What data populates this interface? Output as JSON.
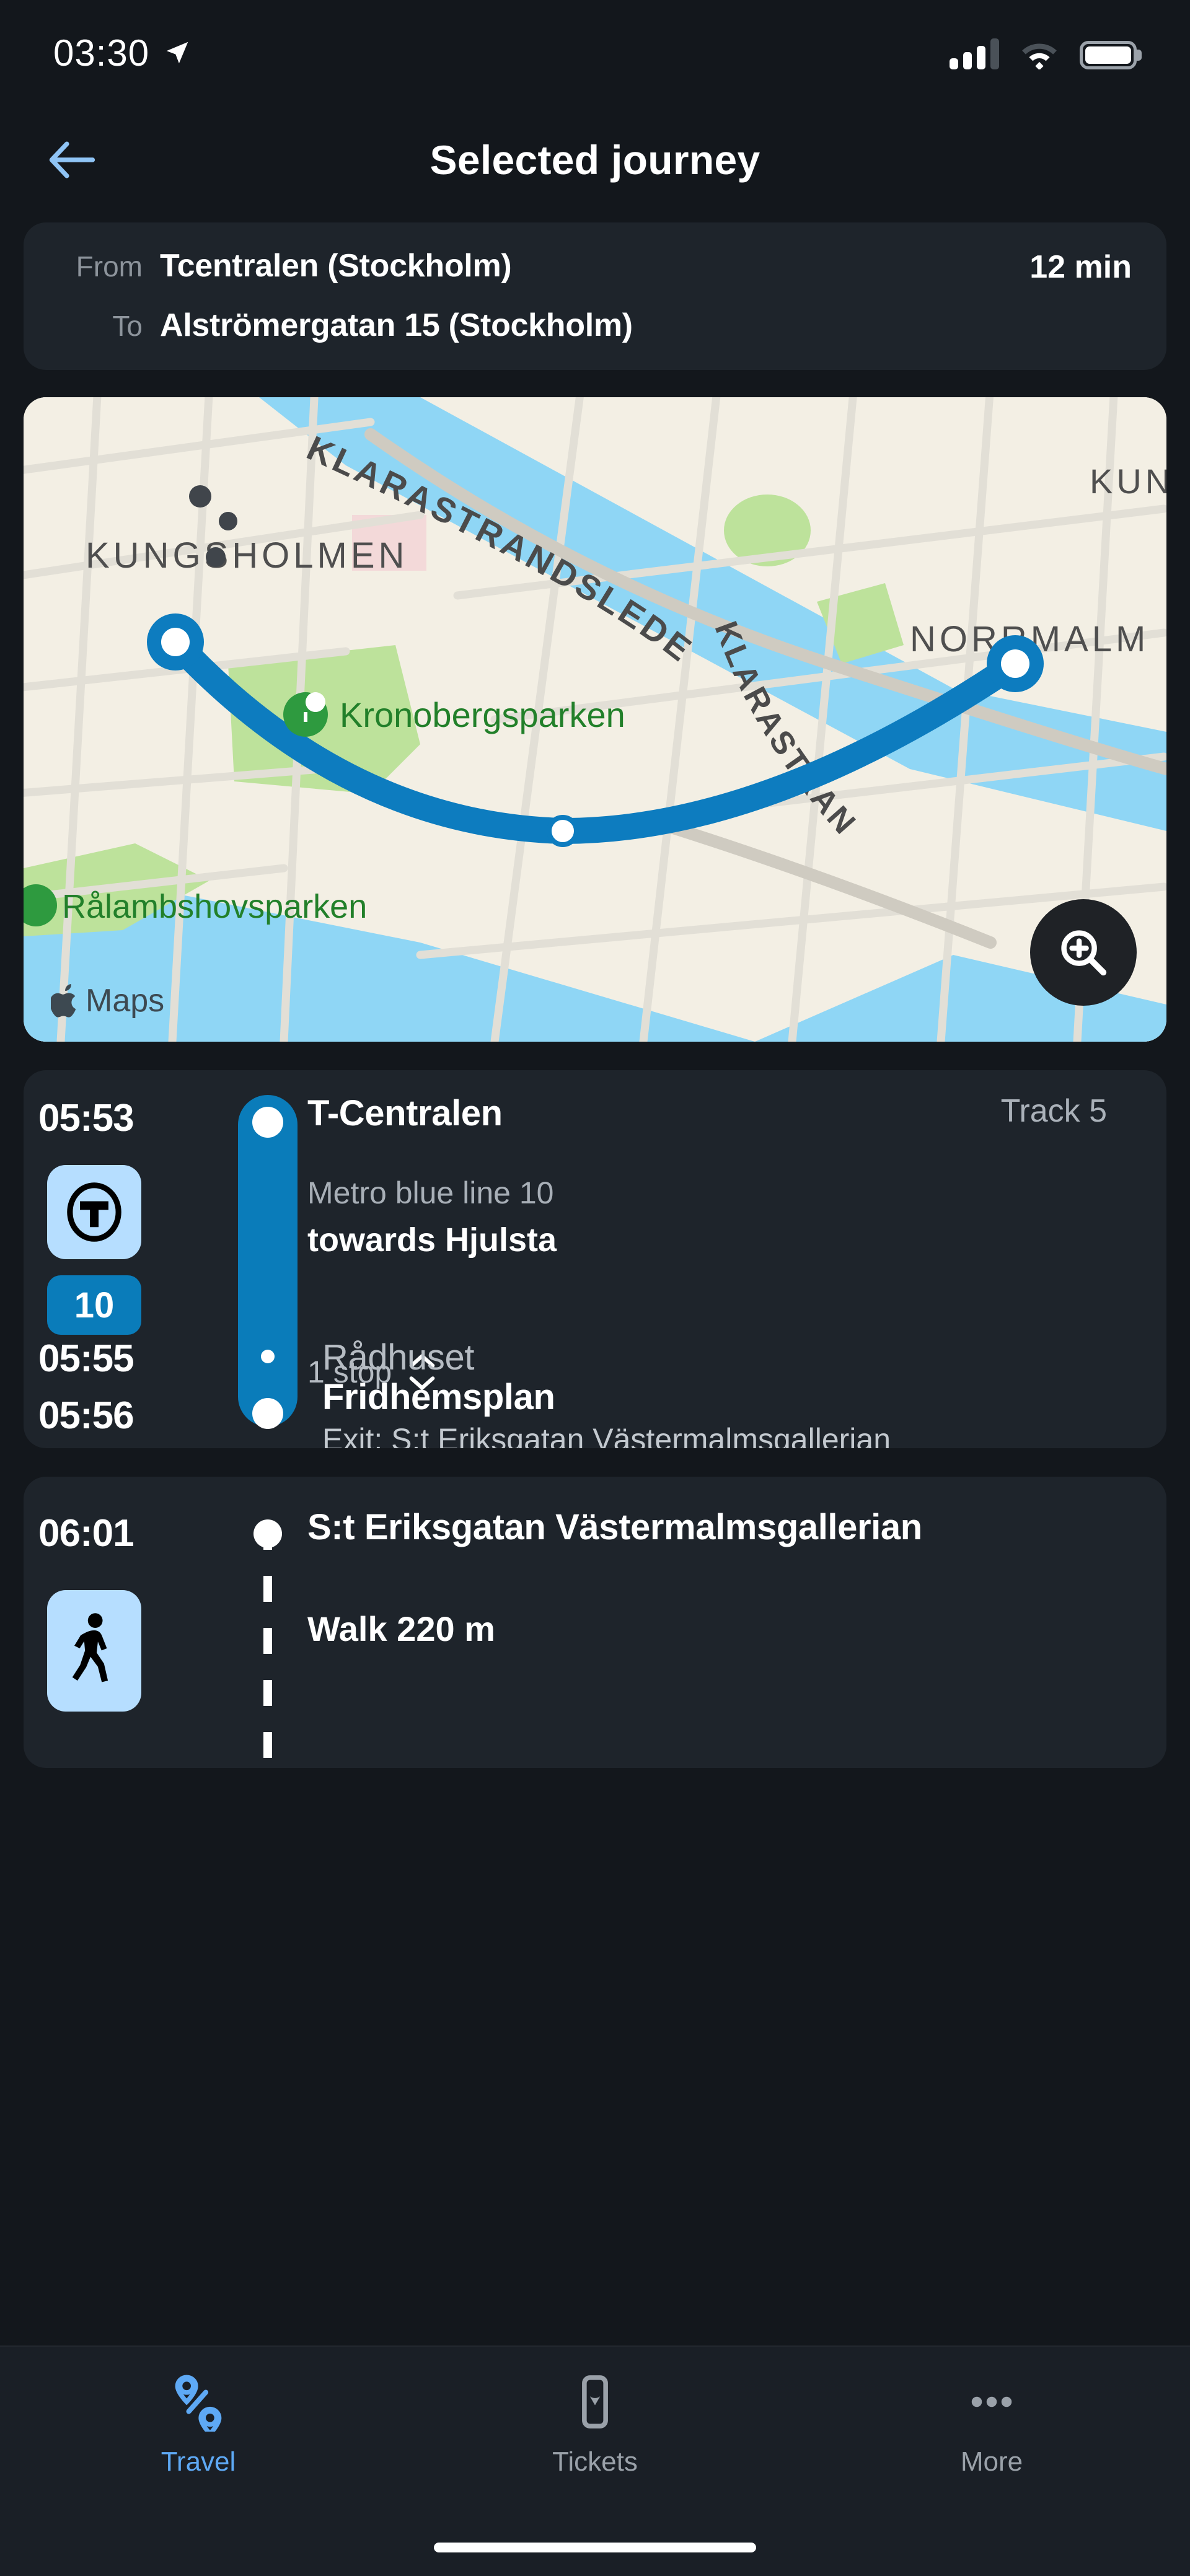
{
  "status_bar": {
    "time": "03:30",
    "location_icon": "location-arrow-icon",
    "signal_icon": "cellular-signal-icon",
    "wifi_icon": "wifi-icon",
    "battery_icon": "battery-full-icon"
  },
  "nav": {
    "back_icon": "arrow-left-icon",
    "title": "Selected journey"
  },
  "journey_summary": {
    "from_label": "From",
    "from_value": "Tcentralen (Stockholm)",
    "to_label": "To",
    "to_value": "Alströmergatan 15 (Stockholm)",
    "duration": "12 min"
  },
  "map": {
    "attribution": "Maps",
    "apple_icon": "apple-logo-icon",
    "zoom_button_icon": "magnifier-plus-icon",
    "labels": {
      "district_left": "KUNGSHOLMEN",
      "district_right": "NORRMALM",
      "district_far_right": "KUNG",
      "road_top": "KLARASTRANDSLEDEN",
      "road_mid": "KLARASTRANDSLEDEN",
      "park_1": "Kronobergsparken",
      "park_2": "Rålambshovsparken"
    },
    "colors": {
      "route": "#0a7cba",
      "land": "#f3efe4",
      "water": "#8fd6f5",
      "park": "#bde29b",
      "road": "#e4e1d8",
      "park_label": "#2e8b2e"
    }
  },
  "legs": [
    {
      "type": "transit",
      "depart_time": "05:53",
      "origin": "T-Centralen",
      "track": "Track 5",
      "service": "Metro blue line 10",
      "direction": "towards Hjulsta",
      "mode_icon": "metro-t-icon",
      "line_number": "10",
      "stops_toggle": "1 stop",
      "chevron_up_icon": "chevron-up-icon",
      "chevron_down_icon": "chevron-down-icon",
      "intermediate": {
        "time": "05:55",
        "name": "Rådhuset"
      },
      "arrive_time": "05:56",
      "destination": "Fridhemsplan",
      "exit_note": "Exit: S:t Eriksgatan Västermalmsgallerian"
    },
    {
      "type": "walk",
      "depart_time": "06:01",
      "origin": "S:t Eriksgatan Västermalmsgallerian",
      "mode_icon": "pedestrian-icon",
      "instruction": "Walk 220 m"
    }
  ],
  "tabbar": {
    "items": [
      {
        "label": "Travel",
        "icon": "route-pins-icon",
        "active": true
      },
      {
        "label": "Tickets",
        "icon": "ticket-phone-icon",
        "active": false
      },
      {
        "label": "More",
        "icon": "ellipsis-icon",
        "active": false
      }
    ]
  },
  "colors": {
    "page_bg": "#13171c",
    "card_bg": "#1e242b",
    "accent_blue": "#0a7cba",
    "link_blue": "#5ea9f5",
    "badge_light_blue": "#b6deff"
  }
}
